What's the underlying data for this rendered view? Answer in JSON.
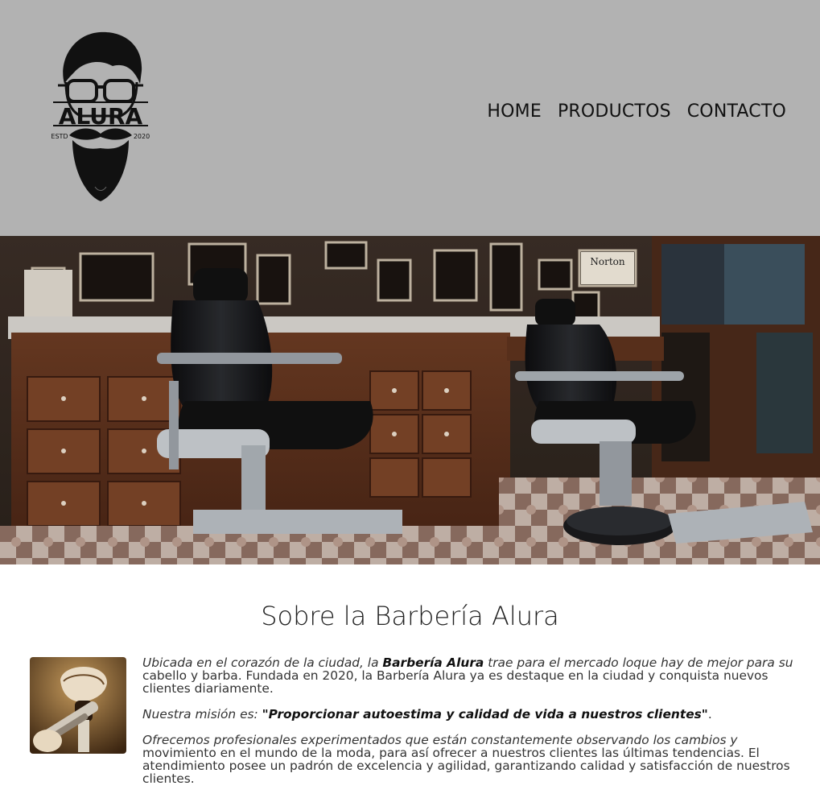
{
  "brand": {
    "logo_text": "ALURA",
    "logo_estd": "ESTD",
    "logo_year": "2020"
  },
  "nav": {
    "home": "HOME",
    "products": "PRODUCTOS",
    "contact": "CONTACTO"
  },
  "hero": {
    "image_sign": "Norton"
  },
  "about": {
    "title": "Sobre la Barbería Alura",
    "p1_before": "Ubicada en el corazón de la ciudad, la ",
    "p1_bold": "Barbería Alura",
    "p1_mid": " trae para el mercado loque hay de mejor para su",
    "p1_rest": " cabello y barba. Fundada en 2020, la Barbería Alura ya es destaque en la ciudad y conquista nuevos clientes diariamente.",
    "p2_label": "Nuestra misión es: ",
    "p2_quote": "\"Proporcionar autoestima y calidad de vida a nuestros clientes\"",
    "p2_end": ".",
    "p3_italic": "Ofrecemos profesionales experimentados que están constantemente observando los cambios y",
    "p3_rest": " movimiento en el mundo de la moda, para así ofrecer a nuestros clientes las últimas tendencias. El atendimiento posee un padrón de excelencia y agilidad, garantizando calidad y satisfacción de nuestros clientes."
  },
  "colors": {
    "header_bg": "#b2b2b2",
    "page_bg": "#ffffff",
    "text": "#222222"
  }
}
